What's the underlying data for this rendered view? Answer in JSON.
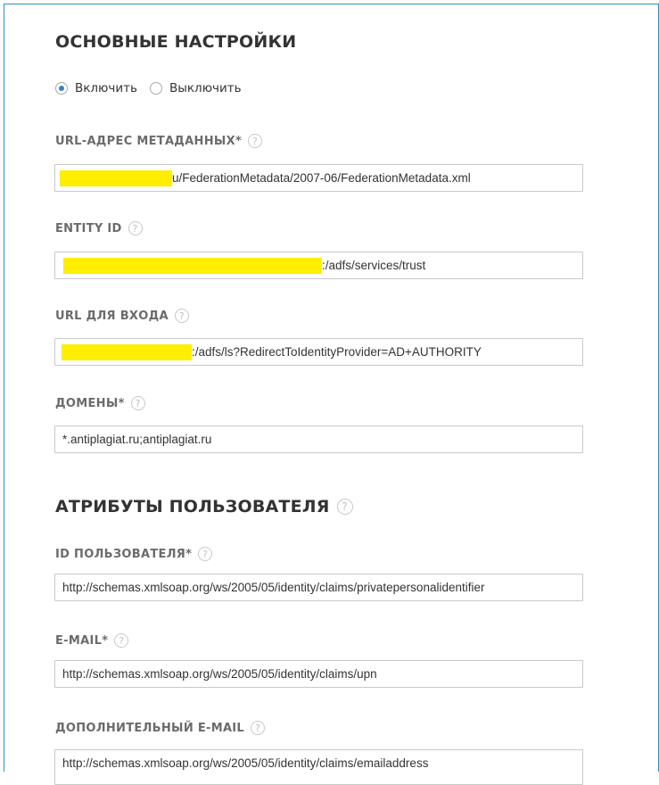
{
  "main_settings": {
    "title": "ОСНОВНЫЕ НАСТРОЙКИ",
    "options": [
      {
        "label": "Включить",
        "selected": true
      },
      {
        "label": "Выключить",
        "selected": false
      }
    ]
  },
  "fields": {
    "metadata_url": {
      "label": "URL-АДРЕС МЕТАДАННЫХ*",
      "value": "u/FederationMetadata/2007-06/FederationMetadata.xml"
    },
    "entity_id": {
      "label": "ENTITY ID",
      "value": ":/adfs/services/trust"
    },
    "login_url": {
      "label": "URL ДЛЯ ВХОДА",
      "value": ":/adfs/ls?RedirectToIdentityProvider=AD+AUTHORITY"
    },
    "domains": {
      "label": "ДОМЕНЫ*",
      "value": "*.antiplagiat.ru;antiplagiat.ru"
    }
  },
  "user_attributes": {
    "title": "АТРИБУТЫ ПОЛЬЗОВАТЕЛЯ",
    "user_id": {
      "label": "ID ПОЛЬЗОВАТЕЛЯ*",
      "value": "http://schemas.xmlsoap.org/ws/2005/05/identity/claims/privatepersonalidentifier"
    },
    "email": {
      "label": "E-MAIL*",
      "value": "http://schemas.xmlsoap.org/ws/2005/05/identity/claims/upn"
    },
    "extra_email": {
      "label": "ДОПОЛНИТЕЛЬНЫЙ E-MAIL",
      "value": "http://schemas.xmlsoap.org/ws/2005/05/identity/claims/emailaddress"
    }
  },
  "help_glyph": "?",
  "colors": {
    "accent": "#2e8fc4",
    "redaction": "#ffee00",
    "radio_dot": "#3a7fc1"
  }
}
